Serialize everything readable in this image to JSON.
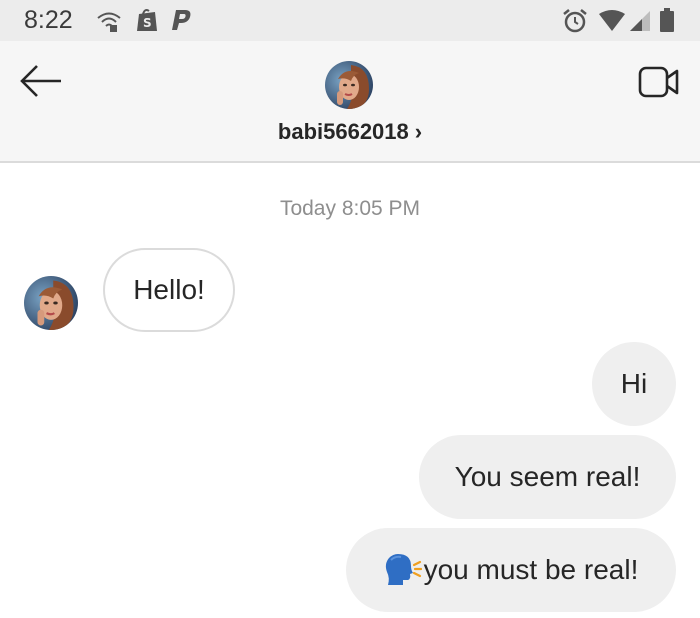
{
  "status_bar": {
    "time": "8:22",
    "icons": [
      "wifi-question-icon",
      "shopify-bag-icon",
      "paypal-icon",
      "alarm-icon",
      "signal-icon",
      "cell-signal-icon",
      "battery-icon"
    ]
  },
  "header": {
    "username": "babi5662018",
    "chevron": "›",
    "icons": [
      "back-arrow-icon",
      "video-call-icon"
    ]
  },
  "thread": {
    "timestamp": "Today 8:05 PM",
    "messages": [
      {
        "from": "them",
        "text": "Hello!"
      },
      {
        "from": "me",
        "text": "Hi"
      },
      {
        "from": "me",
        "text": "You seem real!"
      },
      {
        "from": "me",
        "emoji": "speaking-head-icon",
        "text": "you must be real!"
      }
    ]
  },
  "colors": {
    "status_bg": "#ececec",
    "header_bg": "#f6f6f6",
    "outgoing_bubble": "#efefef",
    "incoming_border": "#dbdbdb",
    "timestamp": "#8e8e8e"
  }
}
